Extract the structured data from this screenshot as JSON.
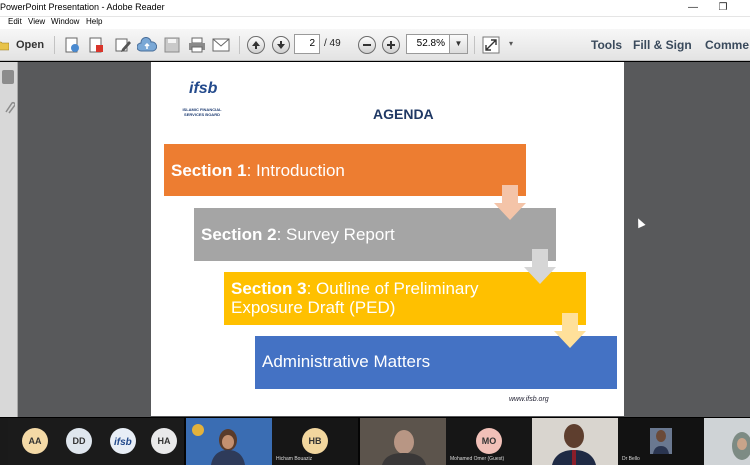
{
  "window": {
    "title": "PowerPoint Presentation - Adobe Reader",
    "minimize_glyph": "—",
    "restore_glyph": "❐"
  },
  "menu": {
    "items": [
      "Edit",
      "View",
      "Window",
      "Help"
    ]
  },
  "toolbar": {
    "open_label": "Open",
    "page_current": "2",
    "page_total": "/ 49",
    "zoom": "52.8%",
    "zoom_drop_glyph": "▼",
    "more_glyph": "▾",
    "tabs": [
      "Tools",
      "Fill & Sign",
      "Comme"
    ]
  },
  "slide": {
    "logo": "ifsb",
    "logo_subtitle": "ISLAMIC FINANCIAL SERVICES BOARD",
    "heading": "AGENDA",
    "items": [
      {
        "bold": "Section 1",
        "rest": ": Introduction",
        "color": "#ED7D31"
      },
      {
        "bold": "Section 2",
        "rest": ": Survey Report",
        "color": "#A5A5A5"
      },
      {
        "bold": "Section 3",
        "rest": ": Outline of Preliminary",
        "line2": "Exposure Draft (PED)",
        "color": "#FFC000"
      },
      {
        "bold": "",
        "rest": "Administrative Matters",
        "color": "#4472C4"
      }
    ],
    "url": "www.ifsb.org"
  },
  "participants": [
    {
      "initials": "AA",
      "color": "#f4d9a6"
    },
    {
      "initials": "DD",
      "color": "#dfe6ee"
    },
    {
      "initials": "HA",
      "color": "#e9e9ea"
    },
    {
      "initials": "HB",
      "color": "#f2d69e",
      "name": "Hicham Bouaziz"
    },
    {
      "initials": "MO",
      "color": "#f1c0b8",
      "name": "Mohamed Omer (Guest)"
    },
    {
      "name": "Dr Bello"
    }
  ],
  "colors": {
    "accent": "#3a4a5c",
    "doc_bg": "#58595b"
  }
}
